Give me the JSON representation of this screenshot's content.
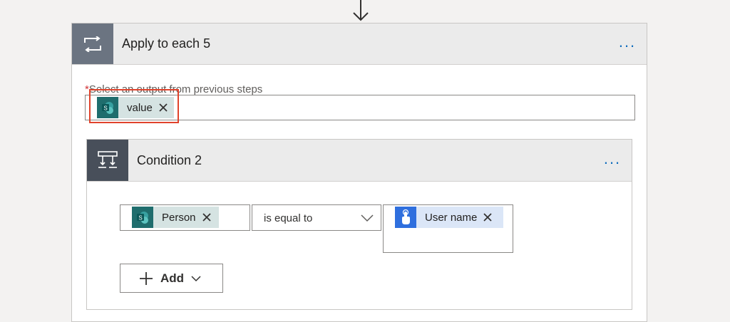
{
  "apply_to_each": {
    "title": "Apply to each 5",
    "more_label": "...",
    "select_label_required": "*",
    "select_label": "Select an output from previous steps",
    "token_value": "value"
  },
  "condition": {
    "title": "Condition 2",
    "more_label": "...",
    "left_token": "Person",
    "operator": "is equal to",
    "right_token": "User name",
    "add_label": "Add"
  },
  "icons": {
    "connector_arrow": "arrow-down-icon",
    "loop": "loop-icon",
    "condition": "condition-icon",
    "sharepoint": "sharepoint-icon",
    "touch": "touch-icon",
    "close": "close-icon",
    "chevron": "chevron-down-icon",
    "plus": "plus-icon"
  },
  "colors": {
    "highlight": "#e0432c",
    "accent": "#0f6cbd",
    "sharepoint": "#1f6d6d",
    "touch_token": "#2f6fde"
  }
}
